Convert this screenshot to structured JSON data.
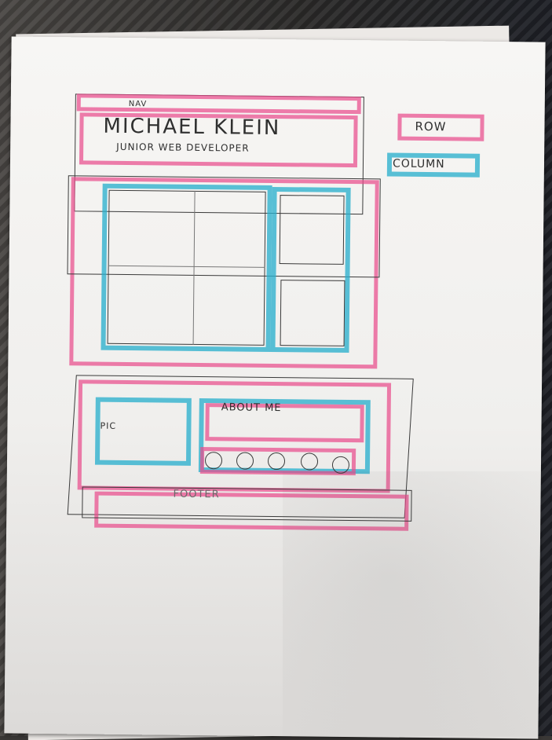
{
  "sketch": {
    "nav_label": "NAV",
    "name": "MICHAEL KLEIN",
    "role": "JUNIOR WEB DEVELOPER",
    "legend_row": "ROW",
    "legend_column": "COLUMN",
    "pic_label": "PIC",
    "about_label": "ABOUT ME",
    "footer_label": "FOOTER",
    "icon_count": 5
  },
  "colors": {
    "row": "#e94c8c",
    "column": "#2cb0cd",
    "pencil": "#3a3a3a"
  }
}
